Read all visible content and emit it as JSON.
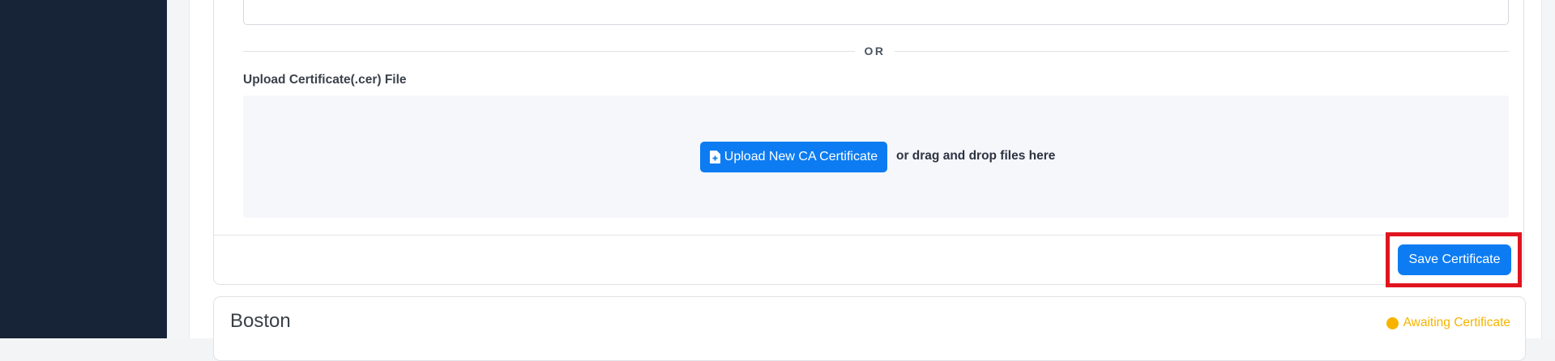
{
  "certificate_form": {
    "divider_text": "OR",
    "upload_label": "Upload Certificate(.cer) File",
    "upload_button_label": "Upload New CA Certificate",
    "upload_icon": "file-plus-icon",
    "drag_drop_text": "or drag and drop files here",
    "save_button_label": "Save Certificate"
  },
  "location_card": {
    "title": "Boston",
    "status_text": "Awaiting Certificate",
    "status_color": "#f6b400"
  },
  "colors": {
    "sidebar": "#172437",
    "primary": "#0d7cf2",
    "highlight": "#e0141f"
  }
}
